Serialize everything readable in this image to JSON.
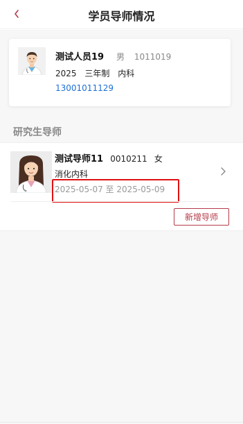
{
  "navbar": {
    "title": "学员导师情况",
    "back_icon": "chevron-left-icon",
    "accent_color": "#b53a48"
  },
  "student": {
    "avatar": "male-doctor-avatar",
    "name": "测试人员19",
    "gender": "男",
    "id": "1011019",
    "year": "2025",
    "program": "三年制",
    "department": "内科",
    "phone": "13001011129",
    "phone_color": "#1d6fd6"
  },
  "section": {
    "title": "研究生导师"
  },
  "mentor": {
    "avatar": "female-doctor-avatar",
    "name": "测试导师11",
    "id": "0010211",
    "gender": "女",
    "department": "消化内科",
    "period": "2025-05-07 至 2025-05-09",
    "highlight_color": "#e01010"
  },
  "actions": {
    "add_mentor_label": "新增导师"
  }
}
